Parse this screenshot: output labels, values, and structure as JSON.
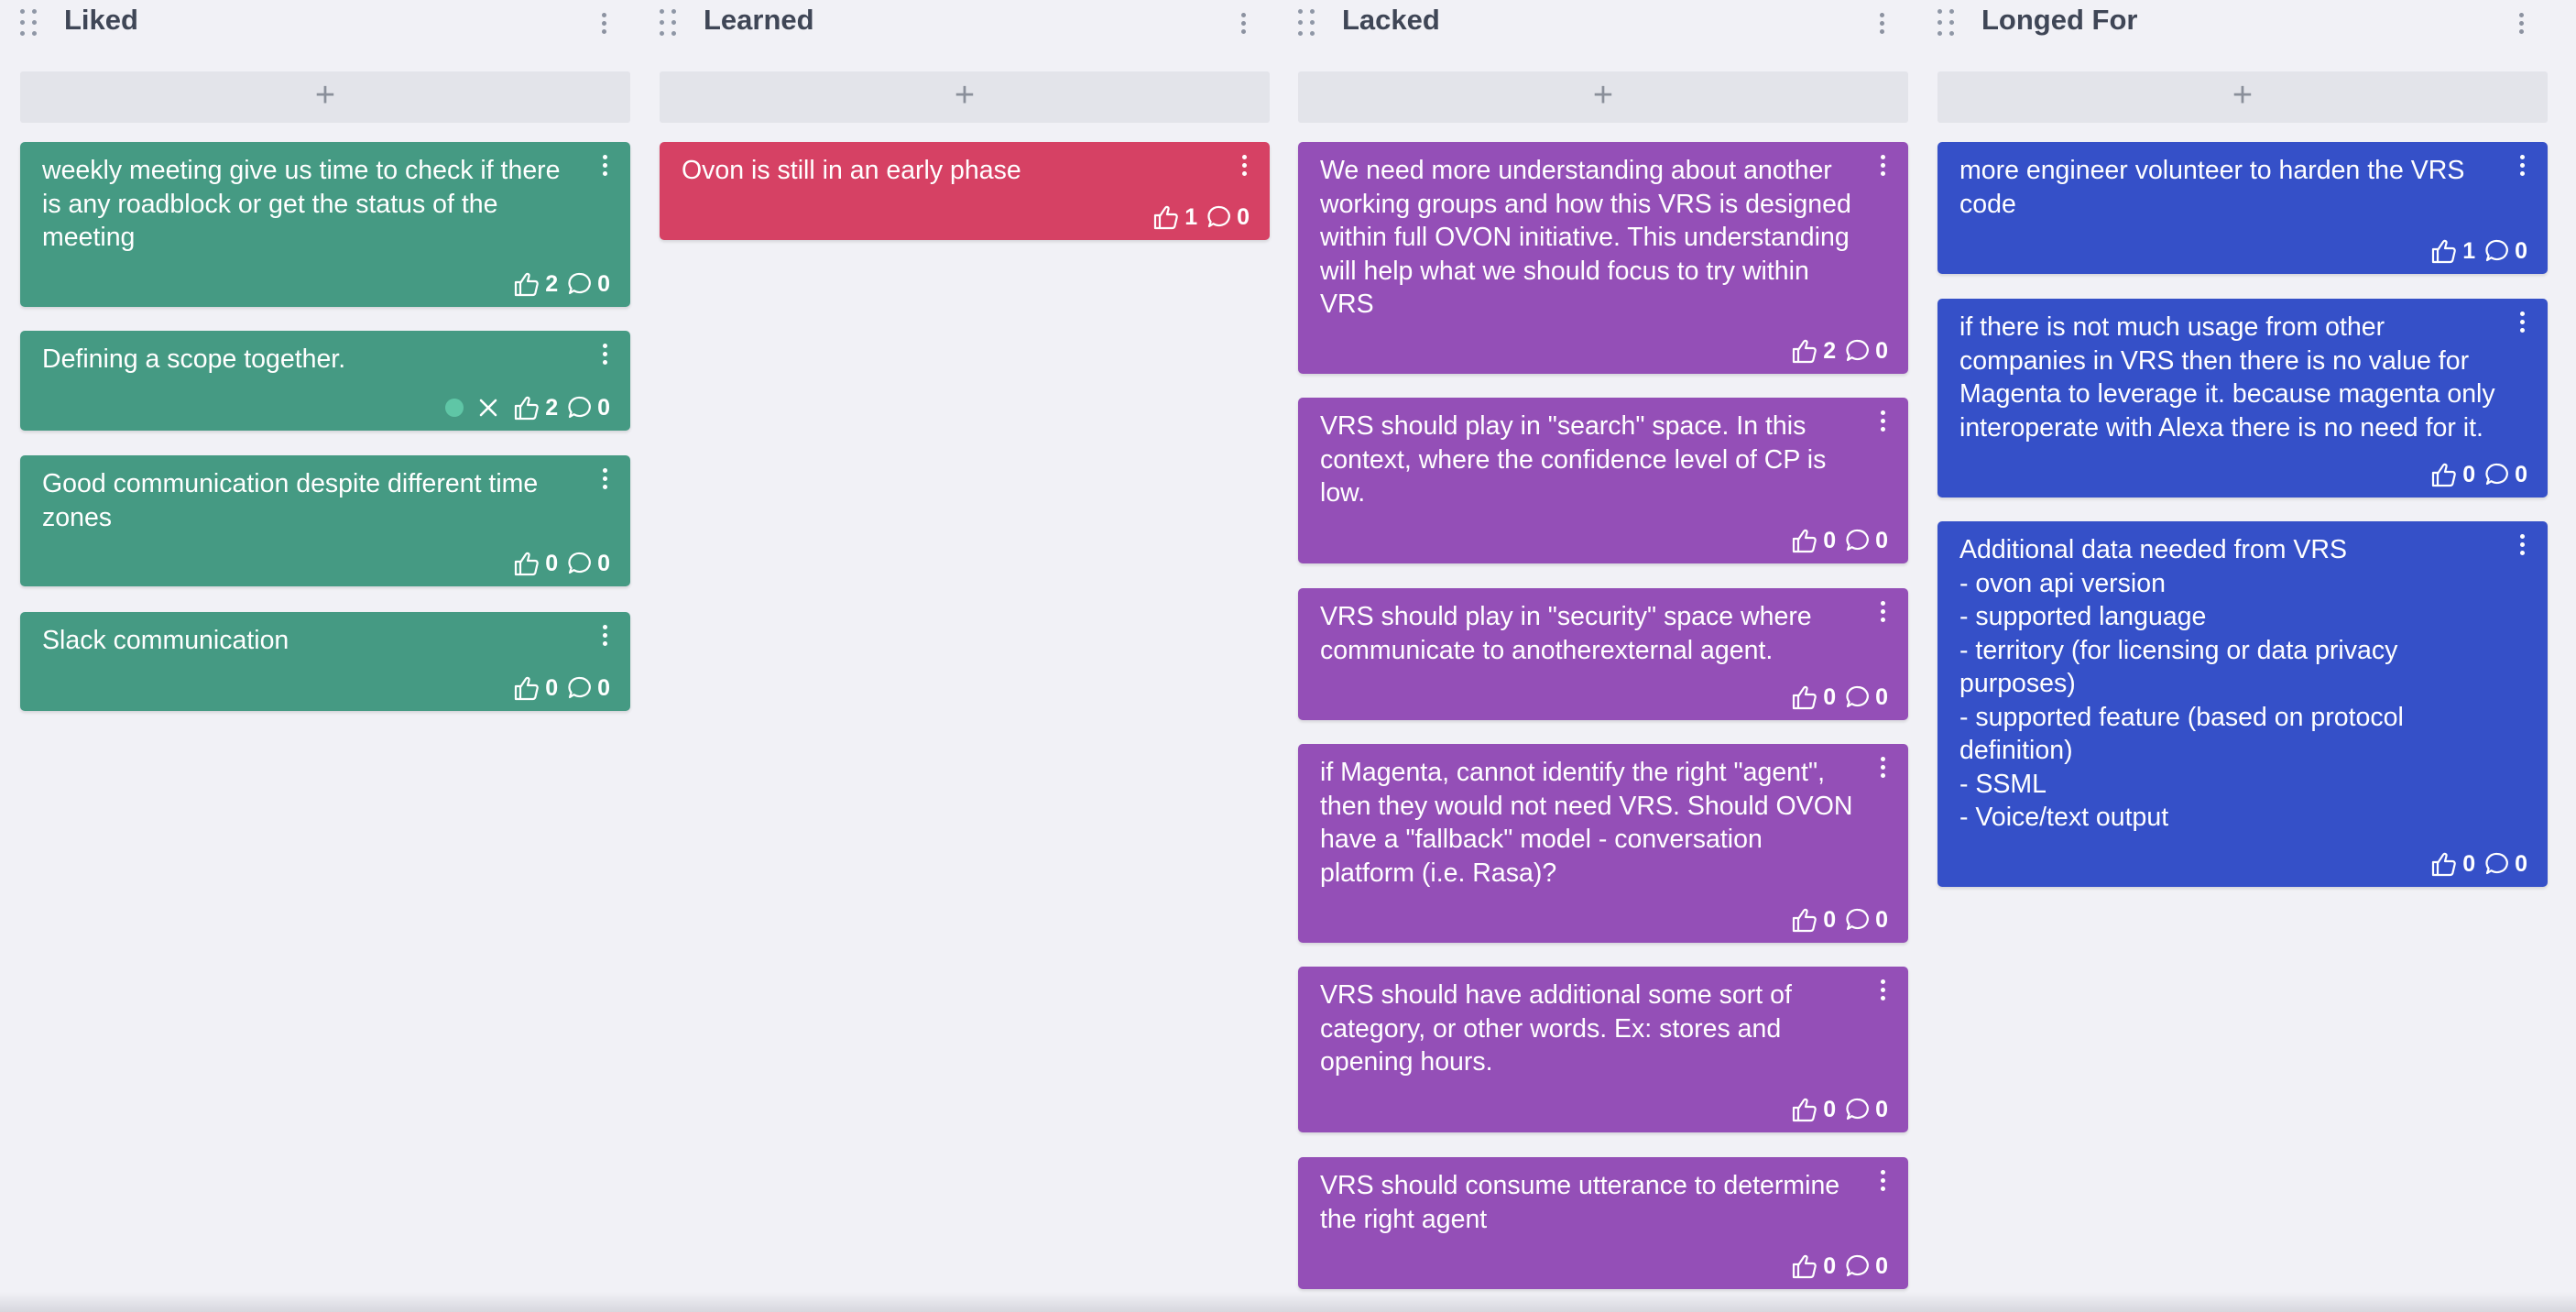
{
  "board": {
    "add_symbol": "+",
    "columns": [
      {
        "title": "Liked",
        "cards": [
          {
            "text": "weekly meeting give us time to check if there is any roadblock or get the status of the meeting",
            "likes": "2",
            "comments": "0"
          },
          {
            "text": "Defining a scope together.",
            "likes": "2",
            "comments": "0",
            "status_dot_color": "#5fc6a6"
          },
          {
            "text": "Good communication despite different time zones",
            "likes": "0",
            "comments": "0"
          },
          {
            "text": "Slack communication",
            "likes": "0",
            "comments": "0"
          }
        ]
      },
      {
        "title": "Learned",
        "cards": [
          {
            "text": "Ovon is still in an early phase",
            "likes": "1",
            "comments": "0"
          }
        ]
      },
      {
        "title": "Lacked",
        "cards": [
          {
            "text": "We need more understanding about another working groups and how this VRS is designed within full OVON initiative. This understanding will help what we should focus to try within VRS",
            "likes": "2",
            "comments": "0"
          },
          {
            "text": "VRS should play in \"search\" space. In this context, where the confidence level of CP is low.",
            "likes": "0",
            "comments": "0"
          },
          {
            "text": "VRS should play in \"security\" space where communicate to anotherexternal agent.",
            "likes": "0",
            "comments": "0"
          },
          {
            "text": "if Magenta, cannot identify the right \"agent\", then they would not need VRS. Should OVON have a \"fallback\" model - conversation platform (i.e. Rasa)?",
            "likes": "0",
            "comments": "0"
          },
          {
            "text": "VRS should have additional some sort of category, or other words. Ex: stores and opening hours.",
            "likes": "0",
            "comments": "0"
          },
          {
            "text": "VRS should consume utterance to determine the right agent",
            "likes": "0",
            "comments": "0"
          }
        ]
      },
      {
        "title": "Longed For",
        "cards": [
          {
            "text": "more engineer volunteer to harden the VRS code",
            "likes": "1",
            "comments": "0"
          },
          {
            "text": "if there is not much usage from other companies in VRS then there is no value for Magenta to leverage it. because magenta only interoperate with Alexa there is no need for it.",
            "likes": "0",
            "comments": "0"
          },
          {
            "text": "Additional data needed from VRS\n- ovon api version\n- supported language\n- territory (for licensing or data privacy purposes)\n- supported feature (based on protocol definition)\n- SSML\n- Voice/text output",
            "likes": "0",
            "comments": "0"
          }
        ]
      }
    ]
  },
  "colors": {
    "background": "#f1f1f6",
    "liked": "#459a83",
    "learned": "#d64164",
    "lacked": "#944fb7",
    "longed_for": "#3550c8"
  }
}
